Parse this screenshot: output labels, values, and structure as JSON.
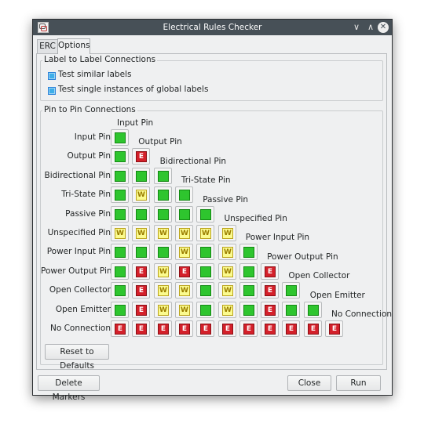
{
  "window": {
    "title": "Electrical Rules Checker",
    "minimize_glyph": "∨",
    "maximize_glyph": "∧",
    "close_glyph": "✕"
  },
  "tabs": [
    {
      "label": "ERC",
      "active": false
    },
    {
      "label": "Options",
      "active": true
    }
  ],
  "label_group": {
    "title": "Label to Label Connections",
    "options": [
      {
        "label": "Test similar labels",
        "checked": true
      },
      {
        "label": "Test single instances of global labels",
        "checked": true
      }
    ]
  },
  "pin_group": {
    "title": "Pin to Pin Connections",
    "pin_types": [
      "Input Pin",
      "Output Pin",
      "Bidirectional Pin",
      "Tri-State Pin",
      "Passive Pin",
      "Unspecified Pin",
      "Power Input Pin",
      "Power Output Pin",
      "Open Collector",
      "Open Emitter",
      "No Connection"
    ],
    "matrix": [
      [
        "ok"
      ],
      [
        "ok",
        "err"
      ],
      [
        "ok",
        "ok",
        "ok"
      ],
      [
        "ok",
        "warn",
        "ok",
        "ok"
      ],
      [
        "ok",
        "ok",
        "ok",
        "ok",
        "ok"
      ],
      [
        "warn",
        "warn",
        "warn",
        "warn",
        "warn",
        "warn"
      ],
      [
        "ok",
        "ok",
        "ok",
        "warn",
        "ok",
        "warn",
        "ok"
      ],
      [
        "ok",
        "err",
        "warn",
        "err",
        "ok",
        "warn",
        "ok",
        "err"
      ],
      [
        "ok",
        "err",
        "warn",
        "warn",
        "ok",
        "warn",
        "ok",
        "err",
        "ok"
      ],
      [
        "ok",
        "err",
        "warn",
        "warn",
        "ok",
        "warn",
        "ok",
        "err",
        "ok",
        "ok"
      ],
      [
        "err",
        "err",
        "err",
        "err",
        "err",
        "err",
        "err",
        "err",
        "err",
        "err",
        "err"
      ]
    ],
    "status_glyphs": {
      "ok": "",
      "warn": "W",
      "err": "E"
    },
    "status_colors": {
      "ok": "#2ec52e",
      "warn": "#fbfb8e",
      "err": "#d4202a"
    },
    "reset_label": "Reset to Defaults"
  },
  "footer": {
    "delete_markers_label": "Delete Markers",
    "close_label": "Close",
    "run_label": "Run"
  }
}
